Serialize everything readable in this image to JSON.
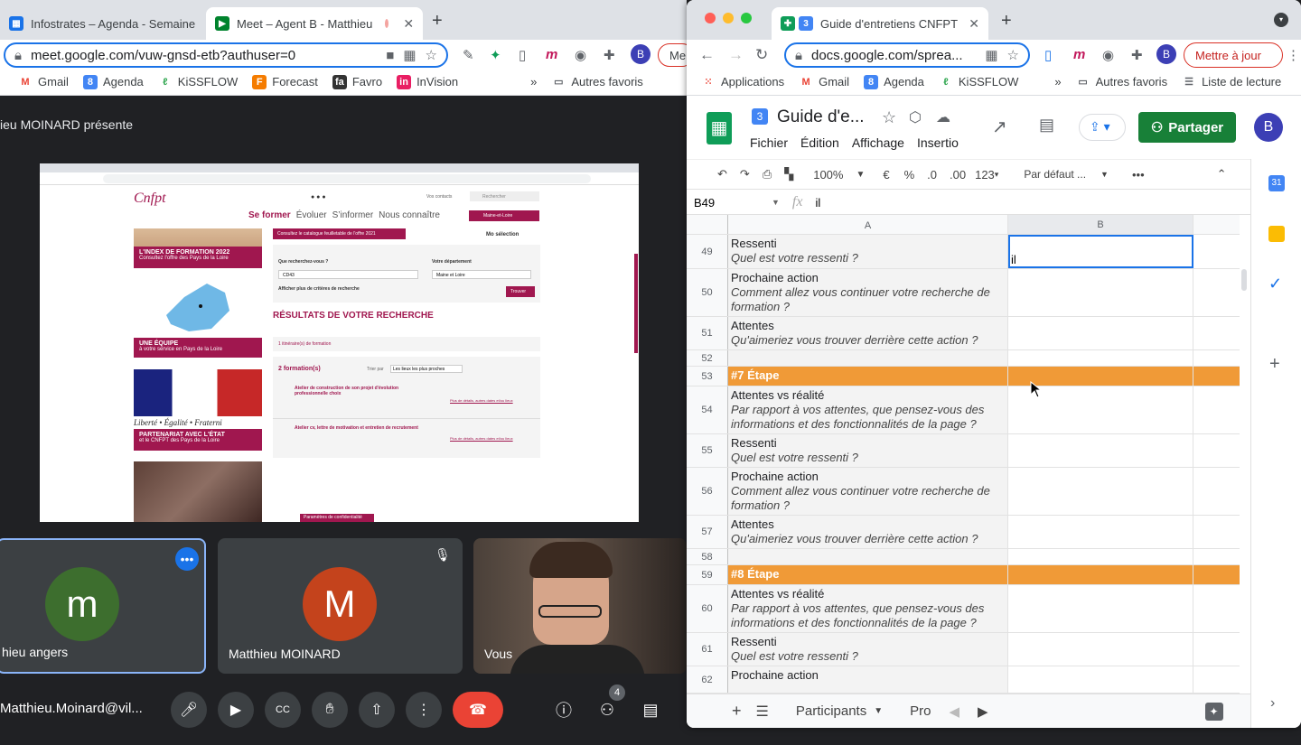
{
  "left_browser": {
    "tabs": [
      {
        "label": "Infostrates – Agenda - Semaine"
      },
      {
        "label": "Meet – Agent B - Matthieu"
      }
    ],
    "url": "meet.google.com/vuw-gnsd-etb?authuser=0",
    "update_btn": "Me",
    "bookmarks": [
      "Gmail",
      "Agenda",
      "KiSSFLOW",
      "Forecast",
      "Favro",
      "InVision"
    ],
    "bookmarks_more": "»",
    "other_favs": "Autres favoris"
  },
  "meet": {
    "presenting": "ieu MOINARD présente",
    "shared": {
      "nav": [
        "Se former",
        "Évoluer",
        "S’informer",
        "Nous connaître"
      ],
      "contact": "Vos contacts",
      "search": "Rechercher",
      "region": "Maine-et-Loire",
      "banner": "Consultez le catalogue feuilletable de l'offre 2021",
      "selection": "Mo sélection",
      "index_title": "L'INDEX DE FORMATION 2022",
      "index_sub": "Consultez l'offre des Pays de la Loire",
      "q_label": "Que recherchez-vous ?",
      "dep_label": "Votre département",
      "q_val": "CD43",
      "dep_val": "Maine et Loire",
      "more_criteria": "Afficher plus de critères de recherche",
      "find": "Trouver",
      "results": "RÉSULTATS DE VOTRE RECHERCHE",
      "itin": "1 itinéraire(s) de formation",
      "count": "2 formation(s)",
      "sort": "Trier par",
      "sort_val": "Les lieux les plus proches",
      "f1": "Atelier de construction de son projet d'évolution professionnelle choix",
      "f2": "Atelier cv, lettre de motivation et entretien de recrutement",
      "details": "Plus de détails, autres dates et/ou lieux",
      "team": "UNE ÉQUIPE",
      "team_sub": "à votre service en Pays de la Loire",
      "rep": "Liberté • Égalité • Fraterni",
      "partner": "PARTENARIAT AVEC L'ÉTAT",
      "partner_sub": "et le CNFPT des Pays de la Loire",
      "privacy": "Paramètres de confidentialité"
    },
    "tiles": [
      {
        "name": "hieu angers",
        "letter": "m"
      },
      {
        "name": "Matthieu MOINARD",
        "letter": "M"
      },
      {
        "name": "Vous"
      }
    ],
    "self_name": "Matthieu.Moinard@vil...",
    "people_count": "4"
  },
  "right_browser": {
    "tab": "Guide d'entretiens CNFPT",
    "url": "docs.google.com/sprea...",
    "update_btn": "Mettre à jour",
    "bookmarks": [
      "Applications",
      "Gmail",
      "Agenda",
      "KiSSFLOW"
    ],
    "other_favs": "Autres favoris",
    "reading": "Liste de lecture"
  },
  "sheets": {
    "doc_title": "Guide d'e...",
    "menus": [
      "Fichier",
      "Édition",
      "Affichage",
      "Insertio"
    ],
    "share": "Partager",
    "zoom": "100%",
    "currency": "€",
    "percent": "%",
    "dec1": ".0",
    "dec2": ".00",
    "fmt123": "123",
    "font": "Par défaut ...",
    "cell_ref": "B49",
    "formula": "il",
    "col_a": "A",
    "col_b": "B",
    "rows": [
      {
        "n": "49",
        "t": "Ressenti",
        "s": "Quel est votre ressenti ?",
        "b": "il",
        "h": 38
      },
      {
        "n": "50",
        "t": "Prochaine action",
        "s": "Comment allez vous continuer votre recherche de formation ?",
        "b": "",
        "h": 53
      },
      {
        "n": "51",
        "t": "Attentes",
        "s": "Qu'aimeriez vous trouver derrière cette action ?",
        "b": "",
        "h": 37
      },
      {
        "n": "52",
        "t": "",
        "s": "",
        "b": "",
        "h": 18
      },
      {
        "n": "53",
        "t": "#7 Étape",
        "s": "",
        "b": "",
        "h": 22,
        "orange": true
      },
      {
        "n": "54",
        "t": "Attentes vs réalité",
        "s": "Par rapport à vos attentes, que pensez-vous des informations et des fonctionnalités de la page ?",
        "b": "",
        "h": 53
      },
      {
        "n": "55",
        "t": "Ressenti",
        "s": "Quel est votre ressenti ?",
        "b": "",
        "h": 37
      },
      {
        "n": "56",
        "t": "Prochaine action",
        "s": "Comment allez vous continuer votre recherche de formation ?",
        "b": "",
        "h": 53
      },
      {
        "n": "57",
        "t": "Attentes",
        "s": "Qu'aimeriez vous trouver derrière cette action ?",
        "b": "",
        "h": 37
      },
      {
        "n": "58",
        "t": "",
        "s": "",
        "b": "",
        "h": 18
      },
      {
        "n": "59",
        "t": "#8 Étape",
        "s": "",
        "b": "",
        "h": 22,
        "orange": true
      },
      {
        "n": "60",
        "t": "Attentes vs réalité",
        "s": "Par rapport à vos attentes, que pensez-vous des informations et des fonctionnalités de la page ?",
        "b": "",
        "h": 53
      },
      {
        "n": "61",
        "t": "Ressenti",
        "s": "Quel est votre ressenti ?",
        "b": "",
        "h": 37
      },
      {
        "n": "62",
        "t": "Prochaine action",
        "s": "",
        "b": "",
        "h": 30
      }
    ],
    "sheet_tabs": [
      "Participants",
      "Pro"
    ]
  },
  "colors": {
    "orange": "#f09a37",
    "share": "#188038",
    "cnfpt": "#a0174f",
    "hangup": "#ea4335"
  }
}
